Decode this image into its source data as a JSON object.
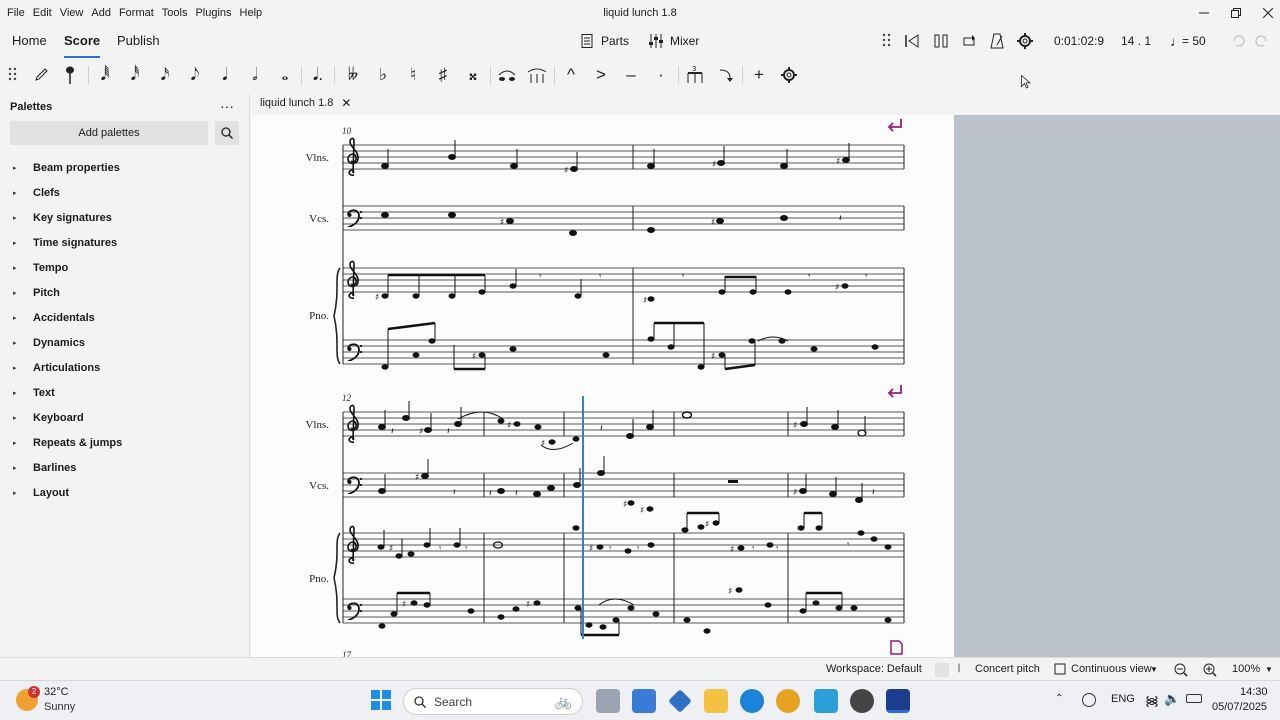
{
  "window": {
    "title": "liquid lunch 1.8",
    "menu": [
      "File",
      "Edit",
      "View",
      "Add",
      "Format",
      "Tools",
      "Plugins",
      "Help"
    ]
  },
  "tabs": {
    "home": "Home",
    "score": "Score",
    "publish": "Publish"
  },
  "header_tools": {
    "parts": "Parts",
    "mixer": "Mixer",
    "time": "0:01:02:9",
    "position": "14 . 1",
    "tempo_prefix": "♩",
    "tempo": "= 50"
  },
  "palettes": {
    "title": "Palettes",
    "add_button": "Add palettes",
    "items": [
      "Beam properties",
      "Clefs",
      "Key signatures",
      "Time signatures",
      "Tempo",
      "Pitch",
      "Accidentals",
      "Dynamics",
      "Articulations",
      "Text",
      "Keyboard",
      "Repeats & jumps",
      "Barlines",
      "Layout"
    ]
  },
  "document": {
    "tab_label": "liquid lunch 1.8"
  },
  "score": {
    "system1": {
      "measure_number": "10",
      "instruments": [
        "Vlns.",
        "Vcs.",
        "Pno."
      ]
    },
    "system2": {
      "measure_number": "12",
      "instruments": [
        "Vlns.",
        "Vcs.",
        "Pno."
      ]
    },
    "system3": {
      "measure_number": "17"
    }
  },
  "statusbar": {
    "workspace": "Workspace: Default",
    "concert_pitch": "Concert pitch",
    "view_mode": "Continuous view",
    "zoom": "100%"
  },
  "taskbar": {
    "weather_temp": "32°C",
    "weather_desc": "Sunny",
    "notification_count": "2",
    "search_placeholder": "Search",
    "language": "ENG",
    "time": "14:30",
    "date": "05/07/2025"
  },
  "colors": {
    "accent": "#2c6fd6",
    "cursor": "#2f7fd8",
    "break_marker": "#a0157d",
    "page_background": "#bcc2cb"
  }
}
